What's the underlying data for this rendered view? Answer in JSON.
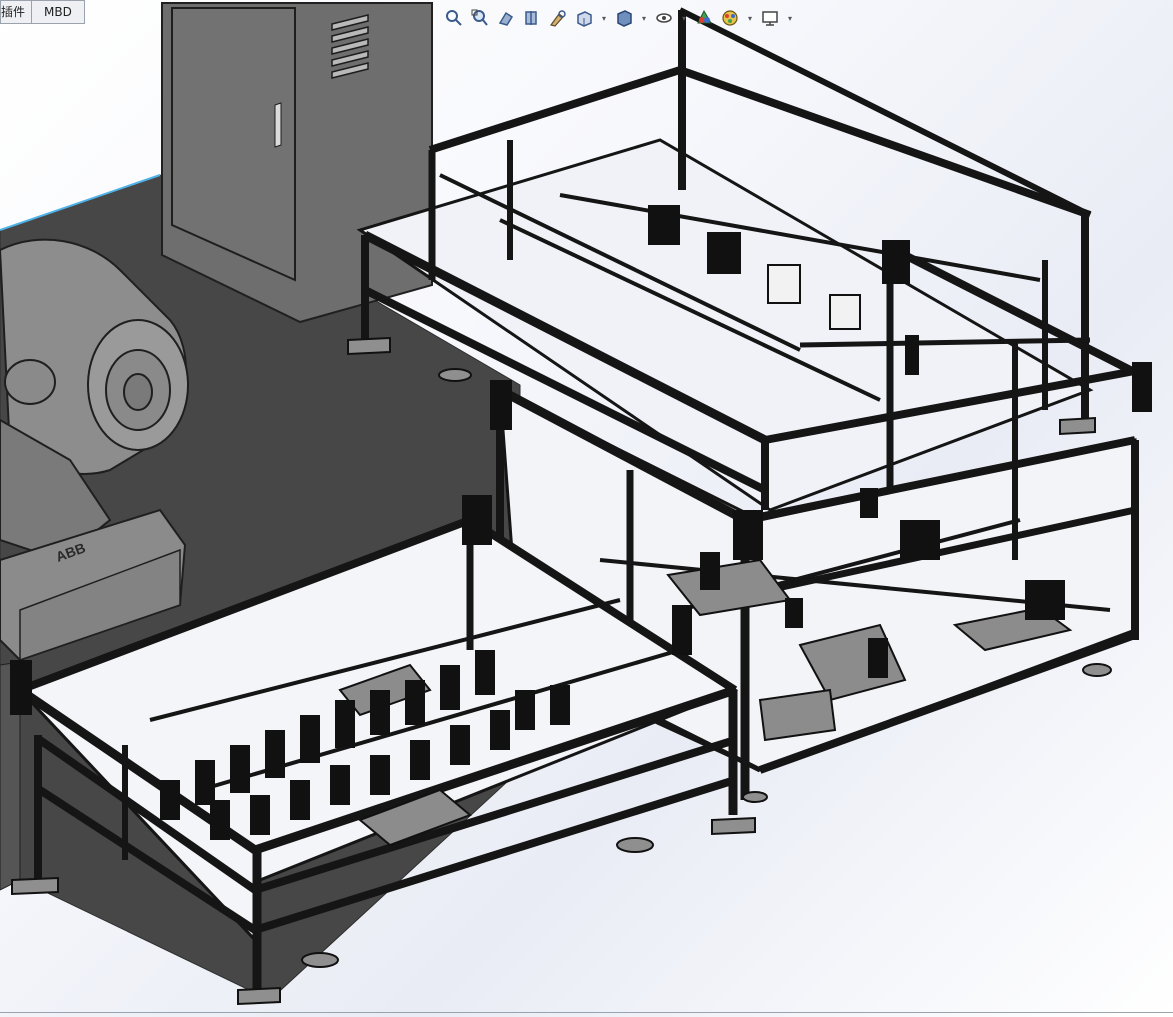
{
  "tabs": [
    {
      "label": "插件"
    },
    {
      "label": "MBD"
    }
  ],
  "toolbar": {
    "icons": [
      "zoom-to-fit-icon",
      "zoom-to-area-icon",
      "previous-view-icon",
      "section-view-icon",
      "dynamic-annotation-icon",
      "view-orientation-icon",
      "display-style-icon",
      "hide-show-items-icon",
      "edit-appearance-icon",
      "apply-scene-icon",
      "view-settings-icon"
    ]
  },
  "scene": {
    "robot_brand": "ABB",
    "colors": {
      "floor": "#4a4a4a",
      "cabinet": "#6b6b6b",
      "frame": "#1a1a1a",
      "robot": "#8a8a8a",
      "floor_edge": "#4fb3e8"
    }
  }
}
